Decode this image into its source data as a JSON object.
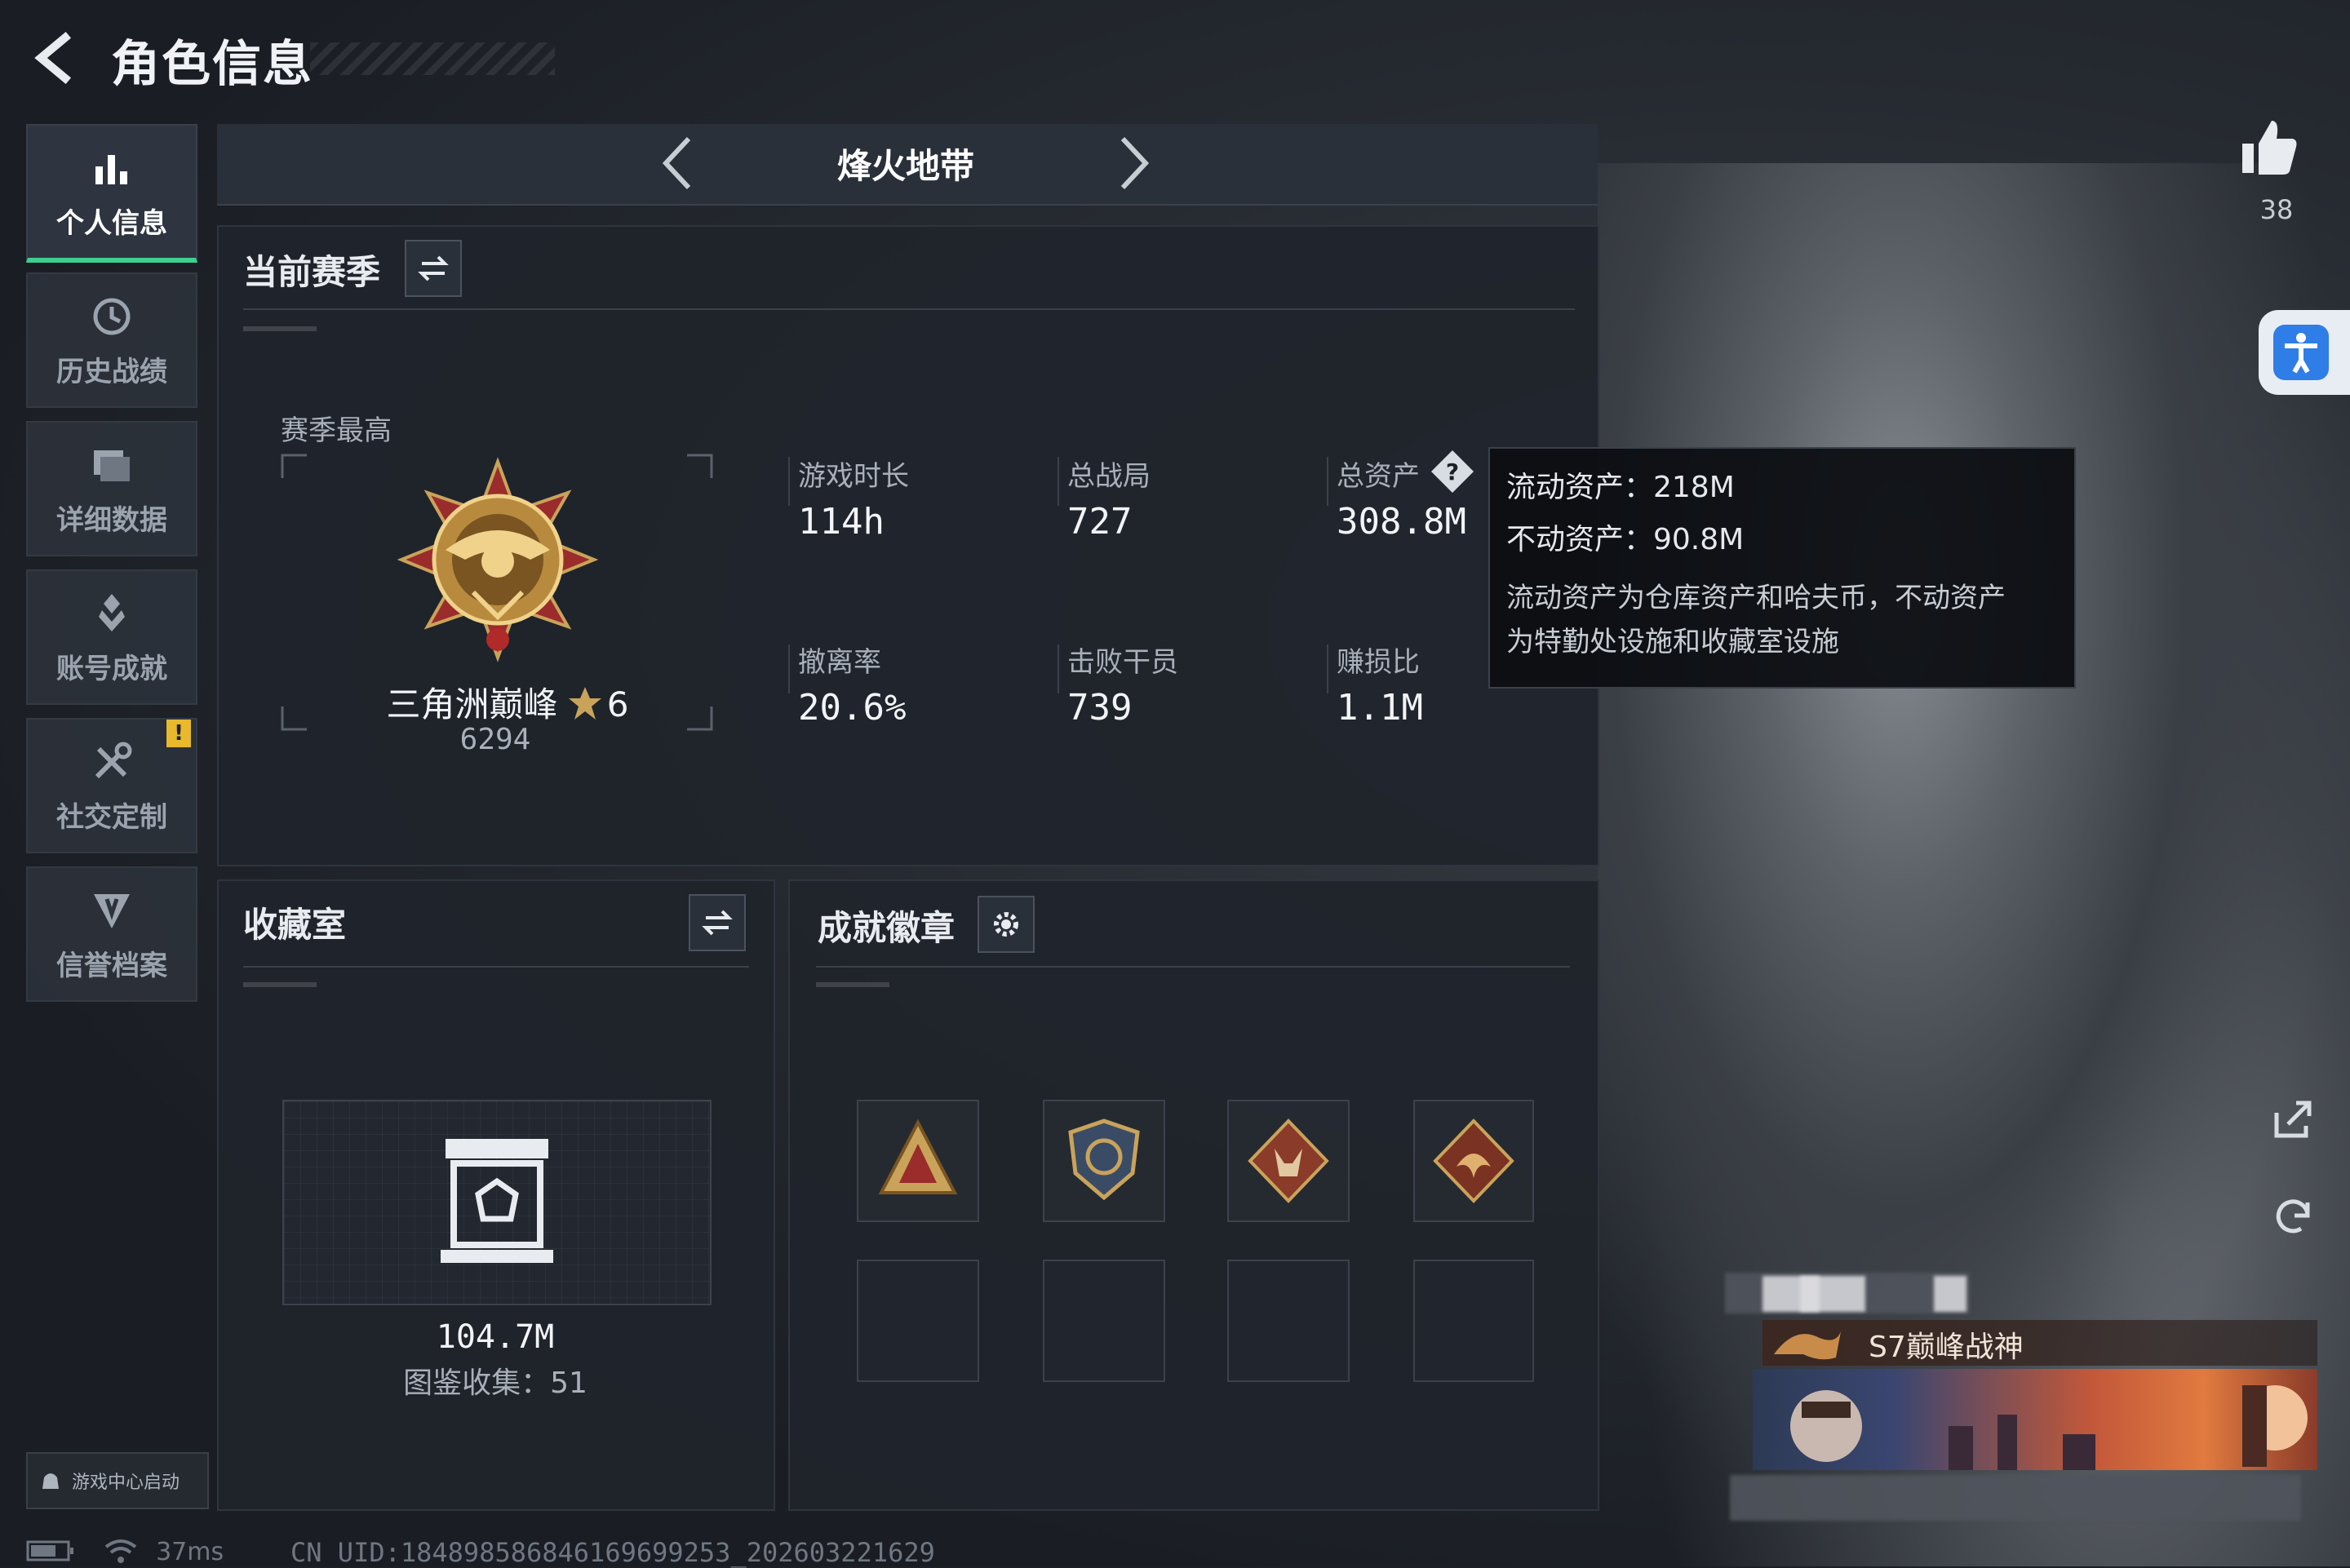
{
  "header": {
    "title": "角色信息"
  },
  "nav": {
    "items": [
      {
        "label": "个人信息",
        "icon": "bar-chart-icon",
        "active": true
      },
      {
        "label": "历史战绩",
        "icon": "history-icon"
      },
      {
        "label": "详细数据",
        "icon": "folder-icon"
      },
      {
        "label": "账号成就",
        "icon": "achievement-icon"
      },
      {
        "label": "社交定制",
        "icon": "tools-icon",
        "badge": "!"
      },
      {
        "label": "信誉档案",
        "icon": "shield-icon"
      }
    ],
    "launch_label": "游戏中心启动"
  },
  "mode": {
    "title": "烽火地带"
  },
  "season": {
    "title": "当前赛季",
    "best_label": "赛季最高",
    "rank_name": "三角洲巅峰",
    "rank_stars": "6",
    "rank_score": "6294",
    "stats": [
      {
        "label": "游戏时长",
        "value": "114h"
      },
      {
        "label": "总战局",
        "value": "727"
      },
      {
        "label": "总资产",
        "value": "308.8M"
      },
      {
        "label": "撤离率",
        "value": "20.6%"
      },
      {
        "label": "击败干员",
        "value": "739"
      },
      {
        "label": "赚损比",
        "value": "1.1M"
      }
    ]
  },
  "tooltip": {
    "liquid": "流动资产：218M",
    "fixed": "不动资产：90.8M",
    "note_line1": "流动资产为仓库资产和哈夫币，不动资产",
    "note_line2": "为特勤处设施和收藏室设施"
  },
  "collection": {
    "title": "收藏室",
    "value": "104.7M",
    "count": "图鉴收集：51"
  },
  "achievements": {
    "title": "成就徽章",
    "badges": [
      "rank-badge",
      "shield-badge",
      "wolf-badge",
      "dragon-badge"
    ]
  },
  "profile": {
    "likes": "38",
    "title_card": "S7巅峰战神"
  },
  "status": {
    "ping": "37ms",
    "uid": "CN UID:184898586846169699253_202603221629"
  },
  "colors": {
    "accent": "#3fcf8e",
    "warning": "#e8b92a",
    "panel": "#1f242b"
  }
}
